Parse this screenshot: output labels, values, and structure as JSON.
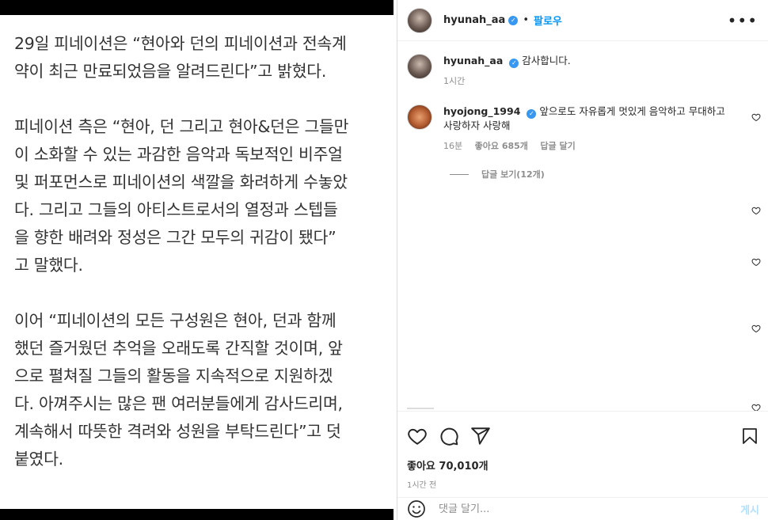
{
  "article": {
    "paragraphs": [
      "29일 피네이션은 “현아와 던의 피네이션과 전속계\n약이 최근 만료되었음을 알려드린다”고 밝혔다.",
      "피네이션 측은 “현아, 던 그리고 현아&던은 그들만\n이 소화할 수 있는 과감한 음악과 독보적인 비주얼\n및 퍼포먼스로 피네이션의 색깔을 화려하게 수놓았\n다. 그리고 그들의 아티스트로서의 열정과 스텝들\n을 향한 배려와 정성은 그간 모두의 귀감이 됐다”\n고 말했다.",
      "이어 “피네이션의 모든 구성원은 현아, 던과 함께\n했던 즐거웠던 추억을 오래도록 간직할 것이며, 앞\n으로 펼쳐질 그들의 활동을 지속적으로 지원하겠\n다. 아껴주시는 많은 팬 여러분들에게 감사드리며,\n계속해서 따뜻한 격려와 성원을 부탁드린다”고 덧\n붙였다."
    ]
  },
  "post": {
    "author": "hyunah_aa",
    "separator": "•",
    "follow_label": "팔로우",
    "more_label": "•••",
    "caption": {
      "author": "hyunah_aa",
      "text": "감사합니다.",
      "time": "1시간"
    },
    "comments": [
      {
        "author": "hyojong_1994",
        "text": "앞으로도 자유롭게 멋있게 음악하고 무대하고 사랑하자 사랑해",
        "time": "16분",
        "likes": "좋아요 685개",
        "reply_label": "답글 달기",
        "view_replies": "답글 보기(12개)"
      }
    ],
    "likes_count": "좋아요 70,010개",
    "posted_time": "1시간 전",
    "comment_placeholder": "댓글 달기...",
    "post_button": "게시"
  },
  "icons": {
    "verified": "verified-badge-icon",
    "like": "heart-icon",
    "comment": "comment-icon",
    "share": "send-icon",
    "save": "bookmark-icon",
    "emoji": "smiley-icon"
  },
  "colors": {
    "link_blue": "#0095f6",
    "verified_blue": "#3897f0",
    "muted_gray": "#8e8e8e",
    "post_btn_disabled": "#b2dffc"
  }
}
